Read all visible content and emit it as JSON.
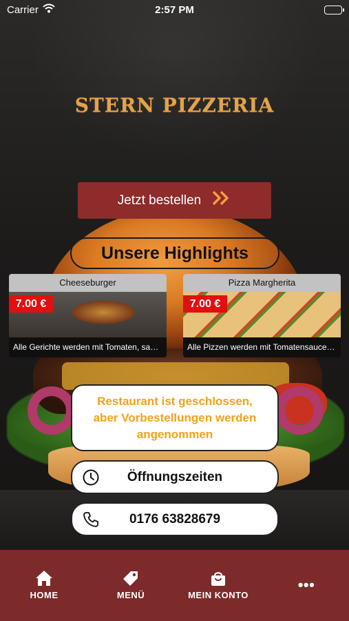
{
  "status_bar": {
    "carrier": "Carrier",
    "time": "2:57 PM"
  },
  "restaurant": {
    "name": "STERN PIZZERIA"
  },
  "order_button": {
    "label": "Jetzt bestellen",
    "icon": "double-chevron-right-icon"
  },
  "highlights": {
    "title": "Unsere Highlights",
    "items": [
      {
        "name": "Cheeseburger",
        "price": "7.00 €",
        "description": "Alle Gerichte werden mit Tomaten, saur..."
      },
      {
        "name": "Pizza Margherita",
        "price": "7.00 €",
        "description": "Alle Pizzen werden mit Tomatensauce u..."
      }
    ]
  },
  "notice": {
    "text": "Restaurant ist geschlossen, aber Vorbestellungen werden angenommen",
    "color": "#f2a21a"
  },
  "opening_hours": {
    "label": "Öffnungszeiten",
    "icon": "clock-icon"
  },
  "phone": {
    "label": "0176 63828679",
    "icon": "phone-icon"
  },
  "tab_bar": {
    "background": "#7d2a2a",
    "tabs": [
      {
        "label": "HOME",
        "icon": "home-icon"
      },
      {
        "label": "MENÜ",
        "icon": "tag-icon"
      },
      {
        "label": "MEIN KONTO",
        "icon": "bag-icon"
      },
      {
        "label": "•••",
        "icon": "more-icon"
      }
    ]
  },
  "colors": {
    "brand_red": "#8e2b2b",
    "title_gold": "#e3a34a",
    "price_red": "#e01010"
  }
}
